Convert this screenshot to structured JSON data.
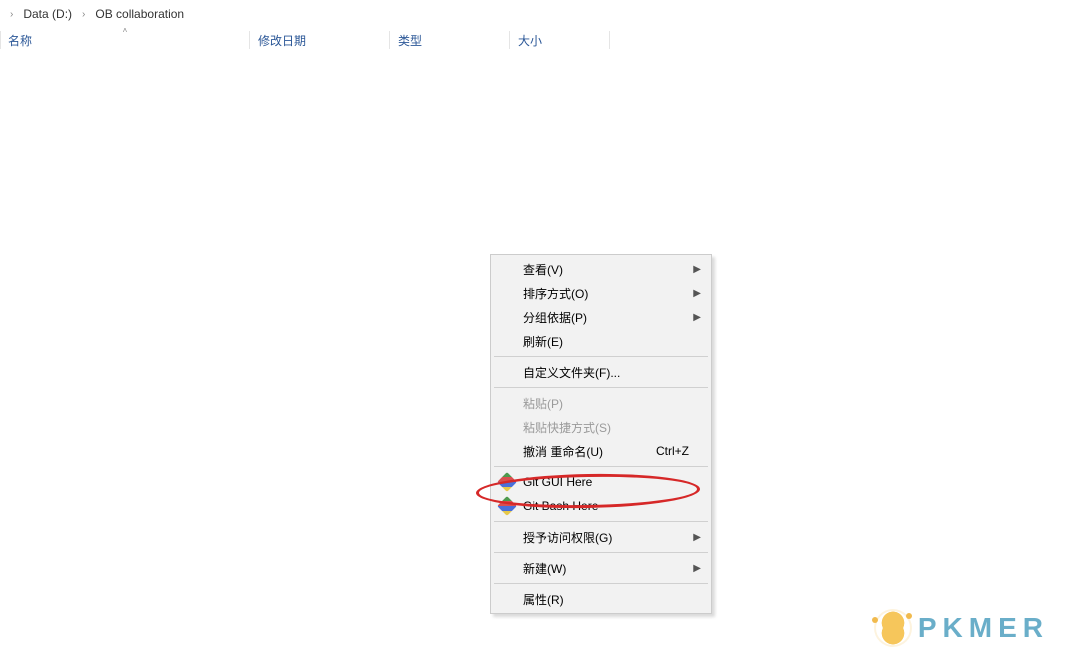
{
  "breadcrumb": {
    "items": [
      "Data (D:)",
      "OB collaboration"
    ]
  },
  "columns": {
    "name": "名称",
    "date": "修改日期",
    "type": "类型",
    "size": "大小"
  },
  "context_menu": {
    "view": "查看(V)",
    "sort": "排序方式(O)",
    "group": "分组依据(P)",
    "refresh": "刷新(E)",
    "custom_folder": "自定义文件夹(F)...",
    "paste": "粘贴(P)",
    "paste_shortcut": "粘贴快捷方式(S)",
    "undo_rename": "撤消 重命名(U)",
    "undo_shortcut": "Ctrl+Z",
    "git_gui": "Git GUI Here",
    "git_bash": "Git Bash Here",
    "grant_access": "授予访问权限(G)",
    "new": "新建(W)",
    "properties": "属性(R)"
  },
  "watermark": {
    "text": "PKMER"
  }
}
